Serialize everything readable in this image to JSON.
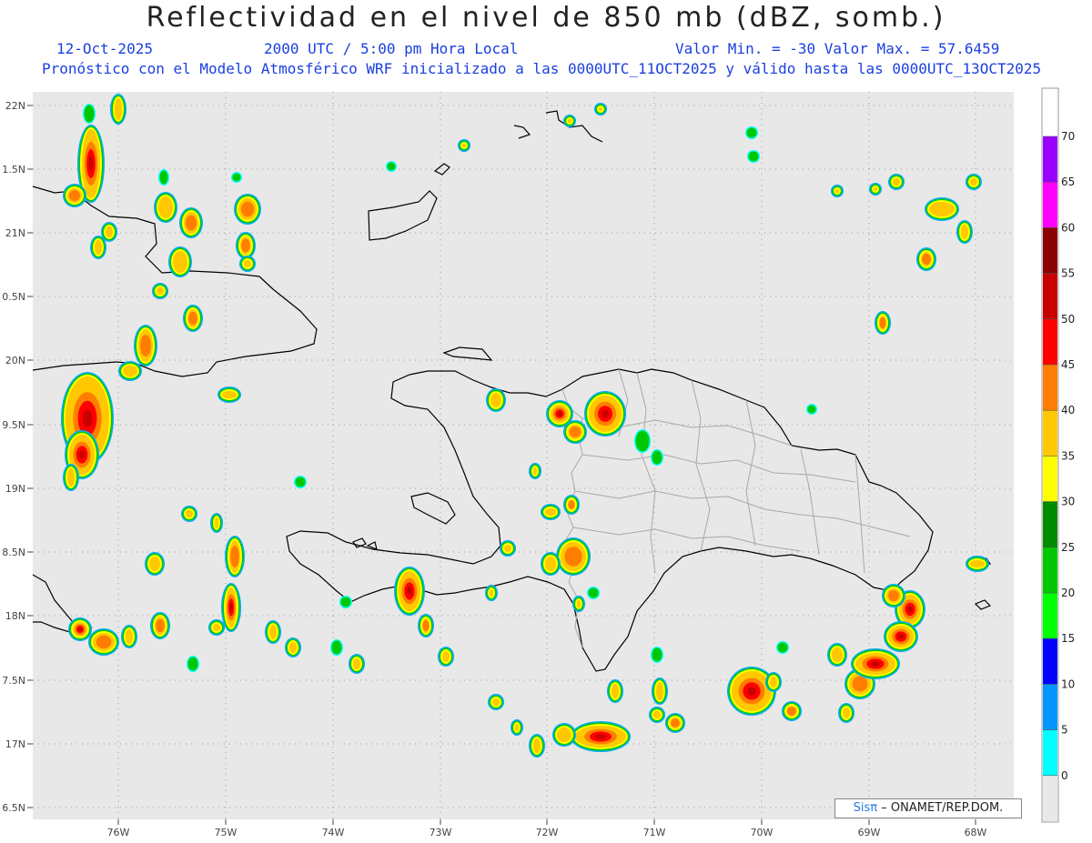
{
  "header": {
    "title": "Reflectividad en el nivel de 850 mb (dBZ, somb.)",
    "date": "12-Oct-2025",
    "time": "2000 UTC / 5:00 pm Hora Local",
    "minmax": "Valor Min. = -30  Valor Max. = 57.6459",
    "description": "Pronóstico con el Modelo Atmosférico WRF inicializado a las 0000UTC_11OCT2025 y válido hasta las  0000UTC_13OCT2025"
  },
  "map": {
    "lat_labels": [
      "22N",
      "1.5N",
      "21N",
      "0.5N",
      "20N",
      "9.5N",
      "19N",
      "8.5N",
      "18N",
      "7.5N",
      "17N",
      "6.5N"
    ],
    "lon_labels": [
      "76W",
      "75W",
      "74W",
      "73W",
      "72W",
      "71W",
      "70W",
      "69W",
      "68W"
    ],
    "background_color": "#e8e8e8",
    "coast_color": "#000000",
    "province_color": "#a8a8a8"
  },
  "colorbar": {
    "labels": [
      "70",
      "65",
      "60",
      "55",
      "50",
      "45",
      "40",
      "35",
      "30",
      "25",
      "20",
      "15",
      "10",
      "5",
      "0"
    ],
    "colors": [
      "#9a00ff",
      "#ff00ff",
      "#8b0000",
      "#c80000",
      "#ff0000",
      "#ff7d00",
      "#ffc800",
      "#ffff00",
      "#008c00",
      "#00c800",
      "#00ff00",
      "#0000ff",
      "#0096ff",
      "#00ffff",
      "#e8e8e8"
    ]
  },
  "credit": {
    "brand": "Sisπ",
    "text": "– ONAMET/REP.DOM."
  }
}
